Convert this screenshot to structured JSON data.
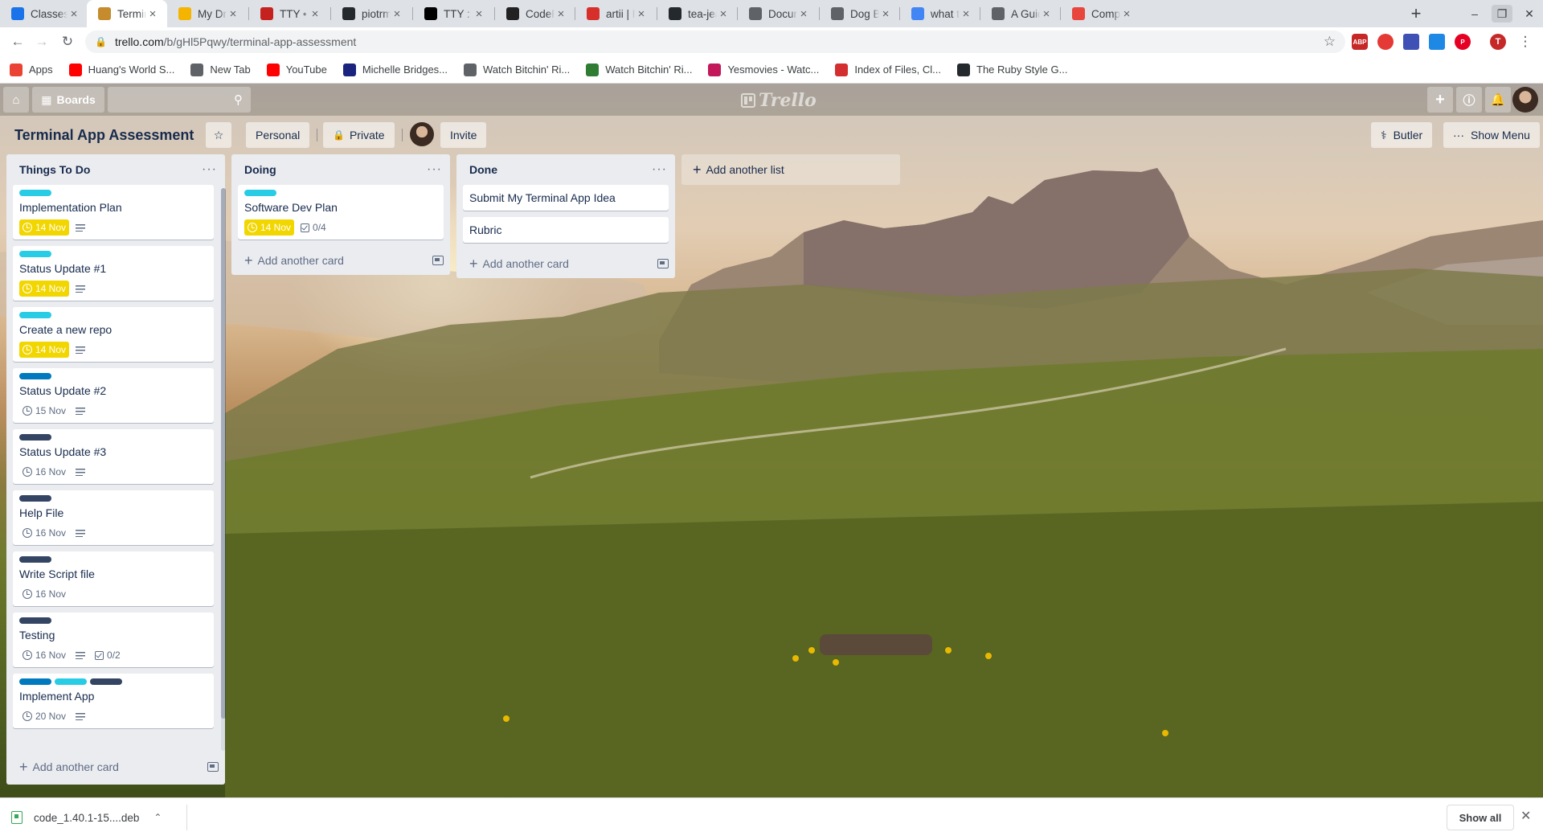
{
  "colors": {
    "label_cyan": "#29cce5",
    "label_blue": "#0079bf",
    "label_navy": "#344563",
    "due_soon": "#f2d600",
    "list_bg": "#ebecf0"
  },
  "browser": {
    "tabs": [
      {
        "title": "Classes an",
        "icon": "codesandbox-icon",
        "color": "#1a73e8"
      },
      {
        "title": "Terminal A",
        "icon": "trello-icon",
        "color": "#c58b2c",
        "active": true
      },
      {
        "title": "My Drive -",
        "icon": "drive-icon",
        "color": "#f4b400"
      },
      {
        "title": "TTY • The",
        "icon": "tty-icon",
        "color": "#c5221f"
      },
      {
        "title": "piotrmura",
        "icon": "github-icon",
        "color": "#24292e"
      },
      {
        "title": "TTY : A Ru",
        "icon": "medium-icon",
        "color": "#000000"
      },
      {
        "title": "CodePen",
        "icon": "codepen-icon",
        "color": "#222222"
      },
      {
        "title": "artii | Ruby",
        "icon": "ruby-icon",
        "color": "#d7302a"
      },
      {
        "title": "tea-jean/a",
        "icon": "github-icon",
        "color": "#24292e"
      },
      {
        "title": "Document",
        "icon": "globe-icon",
        "color": "#5f6368"
      },
      {
        "title": "Dog Breed",
        "icon": "globe-icon",
        "color": "#5f6368"
      },
      {
        "title": "what type",
        "icon": "google-icon",
        "color": "#4285f4"
      },
      {
        "title": "A Guide to",
        "icon": "globe-icon",
        "color": "#5f6368"
      },
      {
        "title": "Compare",
        "icon": "compare-icon",
        "color": "#e8453c"
      }
    ],
    "url_host": "trello.com",
    "url_path": "/b/gHl5Pqwy/terminal-app-assessment",
    "profile_initial": "T",
    "extensions": [
      "ABP",
      "",
      "",
      "",
      ""
    ],
    "bookmarks": [
      {
        "label": "Apps",
        "icon": "apps-grid-icon",
        "color": "#ea4335"
      },
      {
        "label": "Huang's World S...",
        "icon": "youtube-icon",
        "color": "#ff0000"
      },
      {
        "label": "New Tab",
        "icon": "globe-icon",
        "color": "#5f6368"
      },
      {
        "label": "YouTube",
        "icon": "youtube-icon",
        "color": "#ff0000"
      },
      {
        "label": "Michelle Bridges...",
        "icon": "calendar-icon",
        "color": "#1a237e"
      },
      {
        "label": "Watch Bitchin' Ri...",
        "icon": "globe-icon",
        "color": "#5f6368"
      },
      {
        "label": "Watch Bitchin' Ri...",
        "icon": "dollar-icon",
        "color": "#2e7d32"
      },
      {
        "label": "Yesmovies - Watc...",
        "icon": "yesmovies-icon",
        "color": "#c2185b"
      },
      {
        "label": "Index of Files, Cl...",
        "icon": "house-icon",
        "color": "#d32f2f"
      },
      {
        "label": "The Ruby Style G...",
        "icon": "github-icon",
        "color": "#24292e"
      }
    ]
  },
  "trello": {
    "nav": {
      "boards_label": "Boards",
      "logo_text": "Trello"
    },
    "board": {
      "title": "Terminal App Assessment",
      "visibility_team": "Personal",
      "visibility_privacy": "Private",
      "invite_label": "Invite",
      "butler_label": "Butler",
      "menu_label": "Show Menu"
    },
    "lists": [
      {
        "title": "Things To Do",
        "add_card_label": "Add another card",
        "cards": [
          {
            "labels": [
              "cyan"
            ],
            "title": "Implementation Plan",
            "due": "14 Nov",
            "due_soon": true,
            "description": true
          },
          {
            "labels": [
              "cyan"
            ],
            "title": "Status Update #1",
            "due": "14 Nov",
            "due_soon": true,
            "description": true
          },
          {
            "labels": [
              "cyan"
            ],
            "title": "Create a new repo",
            "due": "14 Nov",
            "due_soon": true,
            "description": true
          },
          {
            "labels": [
              "blue"
            ],
            "title": "Status Update #2",
            "due": "15 Nov",
            "due_soon": false,
            "description": true
          },
          {
            "labels": [
              "navy"
            ],
            "title": "Status Update #3",
            "due": "16 Nov",
            "due_soon": false,
            "description": true
          },
          {
            "labels": [
              "navy"
            ],
            "title": "Help File",
            "due": "16 Nov",
            "due_soon": false,
            "description": true
          },
          {
            "labels": [
              "navy"
            ],
            "title": "Write Script file",
            "due": "16 Nov",
            "due_soon": false,
            "description": false
          },
          {
            "labels": [
              "navy"
            ],
            "title": "Testing",
            "due": "16 Nov",
            "due_soon": false,
            "description": true,
            "checklist": "0/2"
          },
          {
            "labels": [
              "blue",
              "cyan",
              "navy"
            ],
            "title": "Implement App",
            "due": "20 Nov",
            "due_soon": false,
            "description": true
          }
        ]
      },
      {
        "title": "Doing",
        "add_card_label": "Add another card",
        "cards": [
          {
            "labels": [
              "cyan"
            ],
            "title": "Software Dev Plan",
            "due": "14 Nov",
            "due_soon": true,
            "description": false,
            "checklist": "0/4"
          }
        ]
      },
      {
        "title": "Done",
        "add_card_label": "Add another card",
        "cards": [
          {
            "labels": [],
            "title": "Submit My Terminal App Idea"
          },
          {
            "labels": [],
            "title": "Rubric"
          }
        ]
      }
    ],
    "add_list_label": "Add another list"
  },
  "downloads": {
    "filename": "code_1.40.1-15....deb",
    "show_all_label": "Show all"
  }
}
